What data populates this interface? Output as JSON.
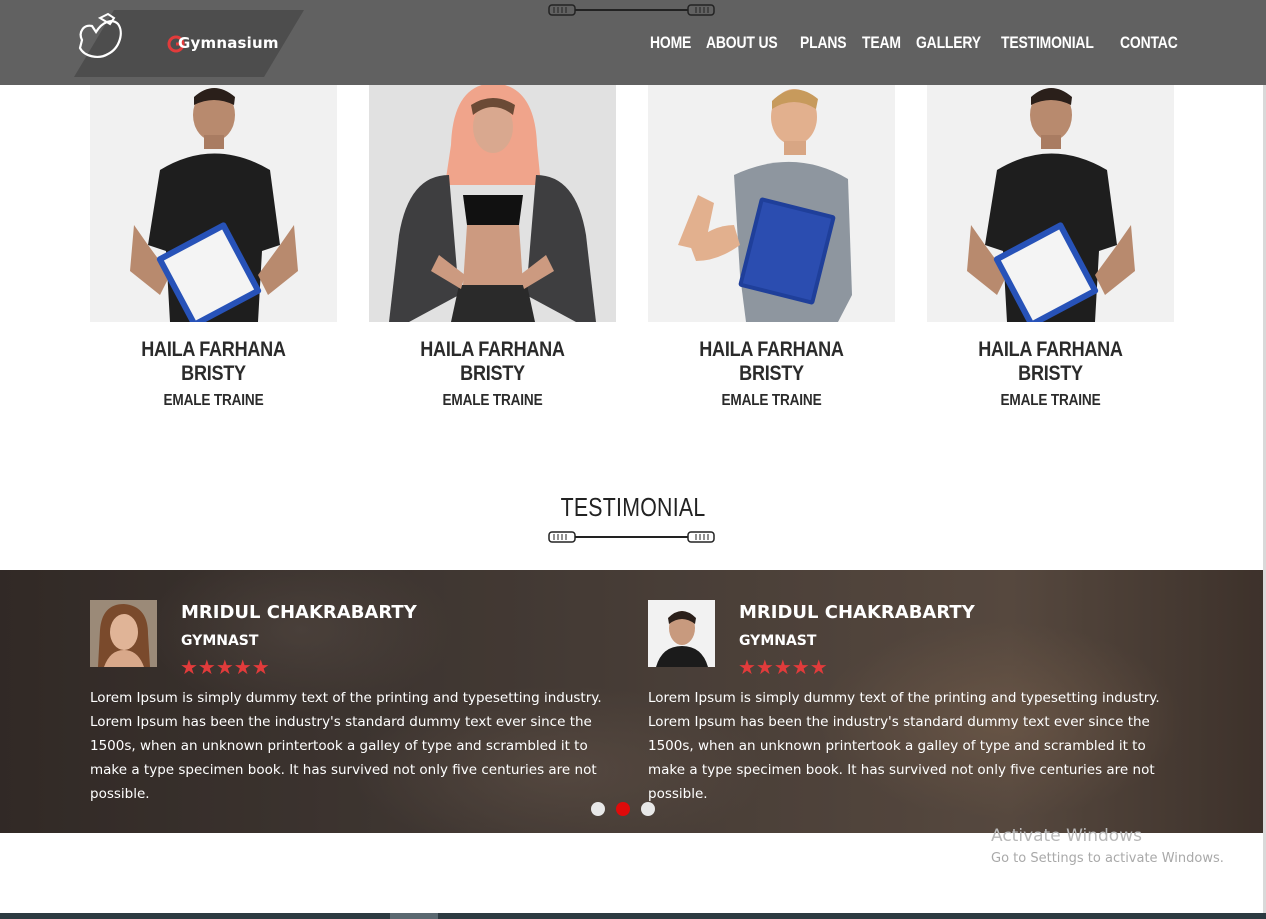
{
  "brand": {
    "logo_text": "Gymnasium",
    "accent": "#e23b3b"
  },
  "nav": {
    "items": [
      "HOME",
      "ABOUT US",
      "PLANS",
      "TEAM",
      "GALLERY",
      "TESTIMONIAL",
      "CONTAC"
    ]
  },
  "team": {
    "members": [
      {
        "name": "HAILA FARHANA BRISTY",
        "role": "EMALE TRAINE"
      },
      {
        "name": "HAILA FARHANA BRISTY",
        "role": "EMALE TRAINE"
      },
      {
        "name": "HAILA FARHANA BRISTY",
        "role": "EMALE TRAINE"
      },
      {
        "name": "HAILA FARHANA BRISTY",
        "role": "EMALE TRAINE"
      }
    ]
  },
  "testimonial": {
    "title": "TESTIMONIAL",
    "items": [
      {
        "name": "MRIDUL CHAKRABARTY",
        "role": "GYMNAST",
        "stars": "★★★★★",
        "text": "Lorem Ipsum is simply dummy text of the printing and typesetting industry. Lorem Ipsum has been the industry's standard dummy text ever since the 1500s, when an unknown printertook a galley of type and scrambled it to make a type specimen book. It has survived not only five centuries are not possible."
      },
      {
        "name": "MRIDUL CHAKRABARTY",
        "role": "GYMNAST",
        "stars": "★★★★★",
        "text": "Lorem Ipsum is simply dummy text of the printing and typesetting industry. Lorem Ipsum has been the industry's standard dummy text ever since the 1500s, when an unknown printertook a galley of type and scrambled it to make a type specimen book. It has survived not only five centuries are not possible."
      }
    ],
    "slider": {
      "count": 3,
      "active_index": 1
    }
  },
  "watermark": {
    "title": "Activate Windows",
    "subtitle": "Go to Settings to activate Windows."
  }
}
